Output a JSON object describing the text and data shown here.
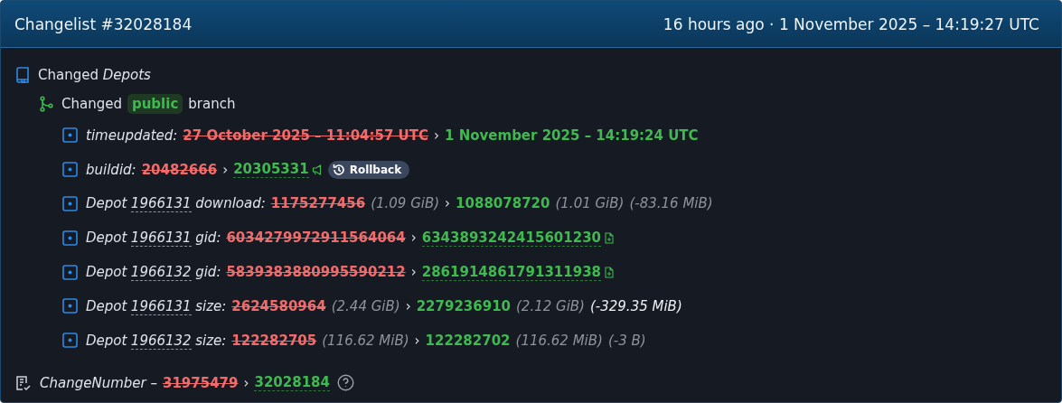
{
  "header": {
    "title": "Changelist #32028184",
    "time": "16 hours ago · 1 November 2025 – 14:19:27 UTC"
  },
  "section": {
    "verb": "Changed",
    "object": "Depots"
  },
  "branch": {
    "verb": "Changed",
    "name": "public",
    "suffix": "branch"
  },
  "changes": [
    {
      "label": "timeupdated:",
      "old": "27 October 2025 – 11:04:57 UTC",
      "sep": "›",
      "new": "1 November 2025 – 14:19:24 UTC",
      "new_link": false
    },
    {
      "label": "buildid:",
      "old": "20482666",
      "sep": "›",
      "new": "20305331",
      "new_link": true,
      "announce": true,
      "button": "Rollback"
    },
    {
      "prefix": "Depot",
      "depot": "1966131",
      "label": "download:",
      "old": "1175277456",
      "old_size": "(1.09 GiB)",
      "sep": "›",
      "new": "1088078720",
      "new_size": "(1.01 GiB)",
      "new_link": false,
      "delta": "(-83.16 MiB)",
      "delta_highlight": false
    },
    {
      "prefix": "Depot",
      "depot": "1966131",
      "label": "gid:",
      "old": "6034279972911564064",
      "sep": "›",
      "new": "6343893242415601230",
      "new_link": true,
      "file_link": true
    },
    {
      "prefix": "Depot",
      "depot": "1966132",
      "label": "gid:",
      "old": "5839383880995590212",
      "sep": "›",
      "new": "2861914861791311938",
      "new_link": true,
      "file_link": true
    },
    {
      "prefix": "Depot",
      "depot": "1966131",
      "label": "size:",
      "old": "2624580964",
      "old_size": "(2.44 GiB)",
      "sep": "›",
      "new": "2279236910",
      "new_size": "(2.12 GiB)",
      "new_link": false,
      "delta": "(-329.35 MiB)",
      "delta_highlight": true
    },
    {
      "prefix": "Depot",
      "depot": "1966132",
      "label": "size:",
      "old": "122282705",
      "old_size": "(116.62 MiB)",
      "sep": "›",
      "new": "122282702",
      "new_size": "(116.62 MiB)",
      "new_link": false,
      "delta": "(-3 B)",
      "delta_highlight": false
    }
  ],
  "footer": {
    "label": "ChangeNumber",
    "dash": "–",
    "old": "31975479",
    "sep": "›",
    "new": "32028184"
  }
}
